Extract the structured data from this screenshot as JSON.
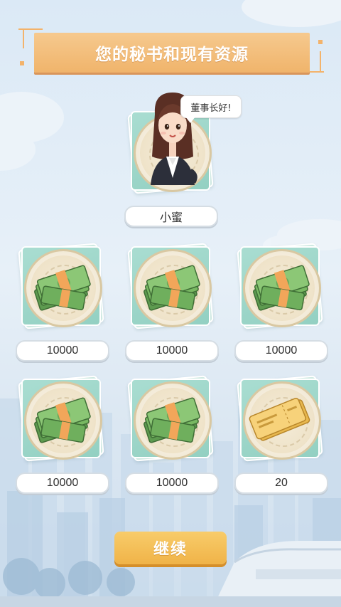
{
  "title": "您的秘书和现有资源",
  "secretary": {
    "greeting": "董事长好!",
    "name": "小蜜"
  },
  "resources": [
    {
      "type": "cash",
      "icon": "cash-stack-icon",
      "value": "10000"
    },
    {
      "type": "cash",
      "icon": "cash-stack-icon",
      "value": "10000"
    },
    {
      "type": "cash",
      "icon": "cash-stack-icon",
      "value": "10000"
    },
    {
      "type": "cash",
      "icon": "cash-stack-icon",
      "value": "10000"
    },
    {
      "type": "cash",
      "icon": "cash-stack-icon",
      "value": "10000"
    },
    {
      "type": "ticket",
      "icon": "ticket-icon",
      "value": "20"
    }
  ],
  "continue_label": "继续",
  "colors": {
    "banner": "#f0b46b",
    "card": "#a9ddd1",
    "button": "#f0b348"
  }
}
